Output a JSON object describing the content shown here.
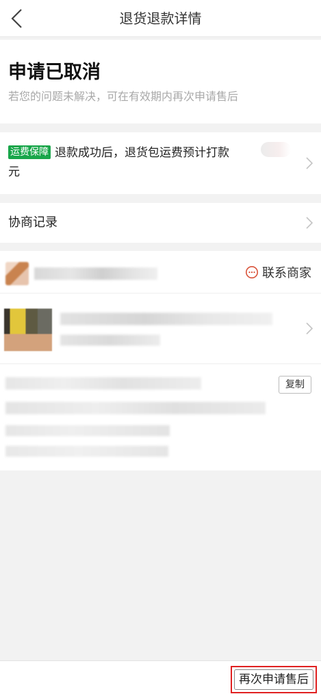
{
  "header": {
    "title": "退货退款详情"
  },
  "status": {
    "title": "申请已取消",
    "subtitle": "若您的问题未解决，可在有效期内再次申请售后"
  },
  "freight": {
    "badge": "运费保障",
    "text_line1": "退款成功后，退货包运费预计打款",
    "text_line2": "元"
  },
  "negotiation": {
    "label": "协商记录"
  },
  "shop": {
    "contact_label": "联系商家"
  },
  "order": {
    "copy_label": "复制"
  },
  "footer": {
    "reapply_label": "再次申请售后"
  },
  "colors": {
    "badge_green": "#18a64a",
    "highlight_red": "#e02020",
    "contact_icon": "#d9533a"
  }
}
